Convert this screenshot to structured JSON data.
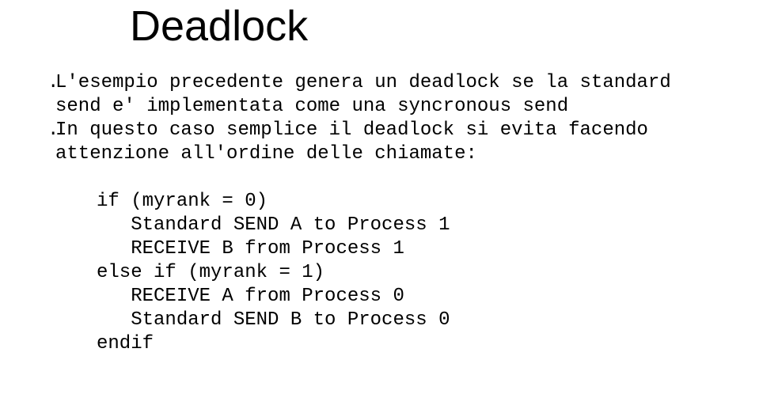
{
  "title": "Deadlock",
  "bullets": [
    "L'esempio precedente genera un deadlock se la standard send e' implementata come una syncronous send",
    "In questo caso semplice il deadlock si evita facendo attenzione all'ordine delle chiamate:"
  ],
  "code": "if (myrank = 0)\n   Standard SEND A to Process 1\n   RECEIVE B from Process 1\nelse if (myrank = 1)\n   RECEIVE A from Process 0\n   Standard SEND B to Process 0\nendif",
  "dot": "."
}
